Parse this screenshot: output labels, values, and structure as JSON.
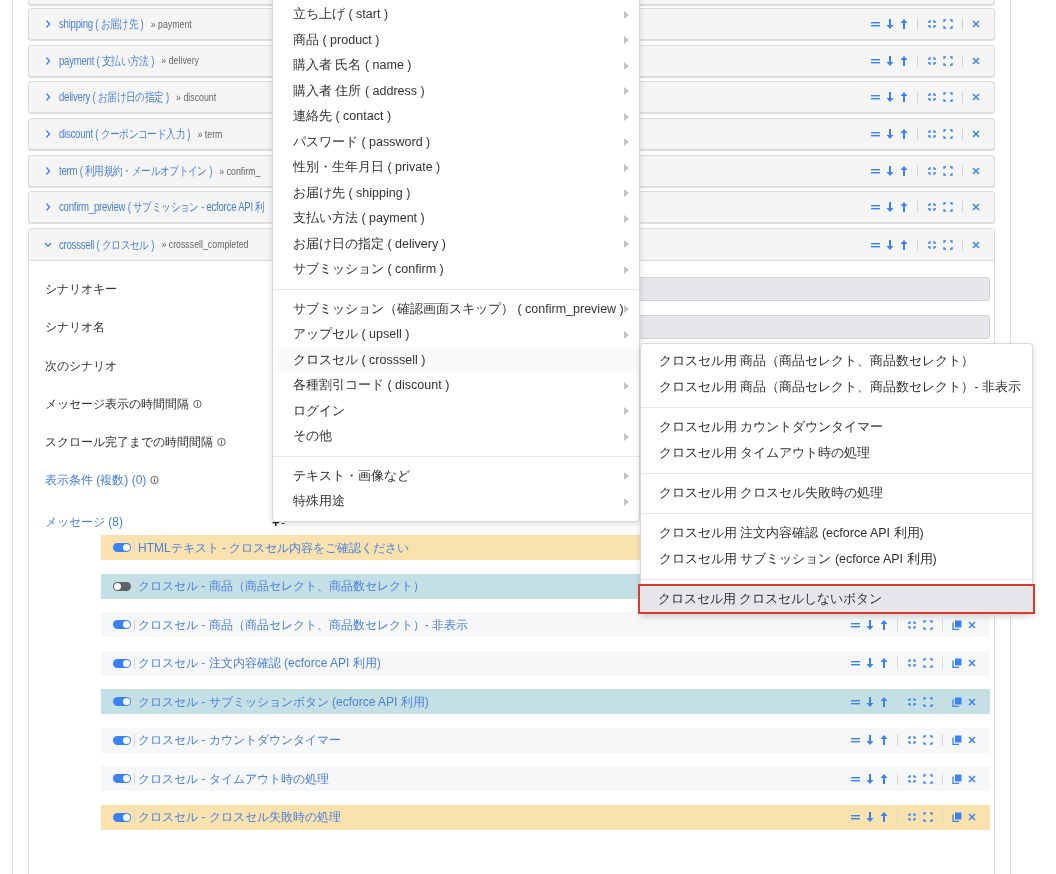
{
  "scenarios": [
    {
      "key": "shipping",
      "label": "( お届け先 )",
      "next": "» payment",
      "expanded": false
    },
    {
      "key": "payment",
      "label": "( 支払い方法 )",
      "next": "» delivery",
      "expanded": false
    },
    {
      "key": "delivery",
      "label": "( お届け日の指定 )",
      "next": "» discount",
      "expanded": false
    },
    {
      "key": "discount",
      "label": "( クーポンコード入力 )",
      "next": "» term",
      "expanded": false
    },
    {
      "key": "term",
      "label": "( 利用規約・メールオプトイン )",
      "next": "» confirm_",
      "expanded": false
    },
    {
      "key": "confirm_preview",
      "label": "( サブミッション - ecforce API 利",
      "expanded": false
    },
    {
      "key": "crosssell",
      "label": "( クロスセル )",
      "next": "» crosssell_completed",
      "expanded": true
    }
  ],
  "form_rows": [
    {
      "kind": "text",
      "label": "シナリオキー",
      "info": false,
      "field": true
    },
    {
      "kind": "text",
      "label": "シナリオ名",
      "info": false,
      "field": true
    },
    {
      "kind": "text",
      "label": "次のシナリオ",
      "info": false,
      "field": false
    },
    {
      "kind": "text",
      "label": "メッセージ表示の時間間隔",
      "info": true,
      "field": false
    },
    {
      "kind": "text",
      "label": "スクロール完了までの時間間隔",
      "info": true,
      "field": false
    },
    {
      "kind": "link",
      "label": "表示条件 (複数) (0)",
      "info": true,
      "field": false
    }
  ],
  "messages_header": {
    "label": "メッセージ (8)",
    "add": "+",
    "remove": "-"
  },
  "messages": [
    {
      "label": "HTMLテキスト - クロスセル内容をご確認ください",
      "on": true,
      "color": "#f9e2ae"
    },
    {
      "label": "クロスセル - 商品（商品セレクト、商品数セレクト）",
      "on": false,
      "color": "#c5e0e5"
    },
    {
      "label": "クロスセル - 商品（商品セレクト、商品数セレクト）- 非表示",
      "on": true,
      "color": "#f6f7f9",
      "actions": true
    },
    {
      "label": "クロスセル - 注文内容確認 (ecforce API 利用)",
      "on": true,
      "color": "#f6f7f9",
      "actions": true
    },
    {
      "label": "クロスセル - サブミッションボタン (ecforce API 利用)",
      "on": true,
      "color": "#c5e0e5",
      "actions": true
    },
    {
      "label": "クロスセル - カウントダウンタイマー",
      "on": true,
      "color": "#f6f7f9",
      "actions": true
    },
    {
      "label": "クロスセル - タイムアウト時の処理",
      "on": true,
      "color": "#f6f7f9",
      "actions": true
    },
    {
      "label": "クロスセル - クロスセル失敗時の処理",
      "on": true,
      "color": "#f9e2ae",
      "actions": true
    }
  ],
  "menu": [
    [
      {
        "label": "立ち上げ ( start )",
        "expanded": false
      },
      {
        "label": "商品 ( product )",
        "expanded": false
      },
      {
        "label": "購入者 氏名 ( name )",
        "expanded": false
      },
      {
        "label": "購入者 住所 ( address )",
        "expanded": false
      },
      {
        "label": "連絡先 ( contact )",
        "expanded": false
      },
      {
        "label": "パスワード ( password )",
        "expanded": false
      },
      {
        "label": "性別・生年月日 ( private )",
        "expanded": false
      },
      {
        "label": "お届け先 ( shipping )",
        "expanded": false
      },
      {
        "label": "支払い方法 ( payment )",
        "expanded": false
      },
      {
        "label": "お届け日の指定 ( delivery )",
        "expanded": false
      },
      {
        "label": "サブミッション ( confirm )",
        "expanded": false
      }
    ],
    [
      {
        "label": "サブミッション（確認画面スキップ） ( confirm_preview )",
        "expanded": false
      },
      {
        "label": "アップセル ( upsell )",
        "expanded": false
      },
      {
        "label": "クロスセル ( crosssell )",
        "expanded": true
      },
      {
        "label": "各種割引コード ( discount )",
        "expanded": false
      },
      {
        "label": "ログイン",
        "expanded": false
      },
      {
        "label": "その他",
        "expanded": false
      }
    ],
    [
      {
        "label": "テキスト・画像など",
        "expanded": false
      },
      {
        "label": "特殊用途",
        "expanded": false
      }
    ]
  ],
  "submenu": [
    [
      {
        "label": "クロスセル用 商品（商品セレクト、商品数セレクト）",
        "selected": false
      },
      {
        "label": "クロスセル用 商品（商品セレクト、商品数セレクト）- 非表示",
        "selected": false
      }
    ],
    [
      {
        "label": "クロスセル用 カウントダウンタイマー",
        "selected": false
      },
      {
        "label": "クロスセル用 タイムアウト時の処理",
        "selected": false
      }
    ],
    [
      {
        "label": "クロスセル用 クロスセル失敗時の処理",
        "selected": false
      }
    ],
    [
      {
        "label": "クロスセル用 注文内容確認 (ecforce API 利用)",
        "selected": false
      },
      {
        "label": "クロスセル用 サブミッション (ecforce API 利用)",
        "selected": false
      }
    ],
    [
      {
        "label": "クロスセル用 クロスセルしないボタン",
        "selected": true
      }
    ]
  ]
}
